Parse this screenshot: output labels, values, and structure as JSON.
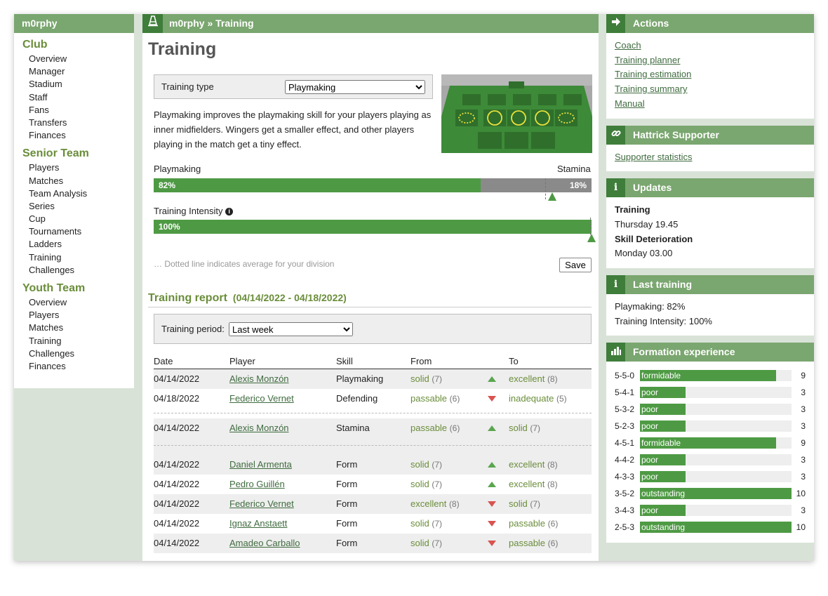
{
  "left": {
    "title": "m0rphy",
    "club_heading": "Club",
    "club_items": [
      "Overview",
      "Manager",
      "Stadium",
      "Staff",
      "Fans",
      "Transfers",
      "Finances"
    ],
    "senior_heading": "Senior Team",
    "senior_items": [
      "Players",
      "Matches",
      "Team Analysis",
      "Series",
      "Cup",
      "Tournaments",
      "Ladders",
      "Training",
      "Challenges"
    ],
    "youth_heading": "Youth Team",
    "youth_items": [
      "Overview",
      "Players",
      "Matches",
      "Training",
      "Challenges",
      "Finances"
    ]
  },
  "main": {
    "breadcrumb": "m0rphy » Training",
    "title": "Training",
    "training_type_label": "Training type",
    "training_type_value": "Playmaking",
    "description": "Playmaking improves the playmaking skill for your players playing as inner midfielders. Wingers get a smaller effect, and other players playing in the match get a tiny effect.",
    "playmaking_label": "Playmaking",
    "stamina_label": "Stamina",
    "playmaking_pct": "82%",
    "stamina_pct": "18%",
    "playmaking_fraction": 0.82,
    "intensity_label": "Training Intensity",
    "intensity_pct": "100%",
    "intensity_fraction": 1.0,
    "hint": "… Dotted line indicates average for your division",
    "save_label": "Save",
    "report_title": "Training report",
    "report_dates": "(04/14/2022 - 04/18/2022)",
    "period_label": "Training period:",
    "period_value": "Last week",
    "columns": [
      "Date",
      "Player",
      "Skill",
      "From",
      "To"
    ],
    "groups": [
      [
        {
          "date": "04/14/2022",
          "player": "Alexis Monzón",
          "skill": "Playmaking",
          "from": "solid",
          "from_n": "(7)",
          "dir": "up",
          "to": "excellent",
          "to_n": "(8)"
        },
        {
          "date": "04/18/2022",
          "player": "Federico Vernet",
          "skill": "Defending",
          "from": "passable",
          "from_n": "(6)",
          "dir": "down",
          "to": "inadequate",
          "to_n": "(5)"
        }
      ],
      [
        {
          "date": "04/14/2022",
          "player": "Alexis Monzón",
          "skill": "Stamina",
          "from": "passable",
          "from_n": "(6)",
          "dir": "up",
          "to": "solid",
          "to_n": "(7)"
        }
      ],
      [
        {
          "date": "04/14/2022",
          "player": "Daniel Armenta",
          "skill": "Form",
          "from": "solid",
          "from_n": "(7)",
          "dir": "up",
          "to": "excellent",
          "to_n": "(8)"
        },
        {
          "date": "04/14/2022",
          "player": "Pedro Guillén",
          "skill": "Form",
          "from": "solid",
          "from_n": "(7)",
          "dir": "up",
          "to": "excellent",
          "to_n": "(8)"
        },
        {
          "date": "04/14/2022",
          "player": "Federico Vernet",
          "skill": "Form",
          "from": "excellent",
          "from_n": "(8)",
          "dir": "down",
          "to": "solid",
          "to_n": "(7)"
        },
        {
          "date": "04/14/2022",
          "player": "Ignaz Anstaett",
          "skill": "Form",
          "from": "solid",
          "from_n": "(7)",
          "dir": "down",
          "to": "passable",
          "to_n": "(6)"
        },
        {
          "date": "04/14/2022",
          "player": "Amadeo Carballo",
          "skill": "Form",
          "from": "solid",
          "from_n": "(7)",
          "dir": "down",
          "to": "passable",
          "to_n": "(6)"
        }
      ]
    ]
  },
  "right": {
    "actions_title": "Actions",
    "actions": [
      "Coach",
      "Training planner",
      "Training estimation",
      "Training summary",
      "Manual"
    ],
    "supporter_title": "Hattrick Supporter",
    "supporter_link": "Supporter statistics",
    "updates_title": "Updates",
    "updates": [
      {
        "label": "Training",
        "value": "Thursday 19.45"
      },
      {
        "label": "Skill Deterioration",
        "value": "Monday 03.00"
      }
    ],
    "last_training_title": "Last training",
    "last_training": [
      "Playmaking: 82%",
      "Training Intensity: 100%"
    ],
    "formation_title": "Formation experience",
    "formations": [
      {
        "name": "5-5-0",
        "level": "formidable",
        "value": 9
      },
      {
        "name": "5-4-1",
        "level": "poor",
        "value": 3
      },
      {
        "name": "5-3-2",
        "level": "poor",
        "value": 3
      },
      {
        "name": "5-2-3",
        "level": "poor",
        "value": 3
      },
      {
        "name": "4-5-1",
        "level": "formidable",
        "value": 9
      },
      {
        "name": "4-4-2",
        "level": "poor",
        "value": 3
      },
      {
        "name": "4-3-3",
        "level": "poor",
        "value": 3
      },
      {
        "name": "3-5-2",
        "level": "outstanding",
        "value": 10
      },
      {
        "name": "3-4-3",
        "level": "poor",
        "value": 3
      },
      {
        "name": "2-5-3",
        "level": "outstanding",
        "value": 10
      }
    ],
    "formation_max": 10
  },
  "colors": {
    "header_green": "#7aa66f",
    "dark_green": "#3f7d3a",
    "bar_green": "#4e9a44",
    "stamina_grey": "#8a8a8a",
    "up_arrow": "#5aa64f",
    "down_arrow": "#d9534f"
  },
  "icons": {
    "main_header": "cone-icon",
    "actions": "arrow-right-icon",
    "supporter": "chain-link-icon",
    "updates": "info-icon",
    "last_training": "info-icon",
    "formation": "bar-chart-icon"
  }
}
